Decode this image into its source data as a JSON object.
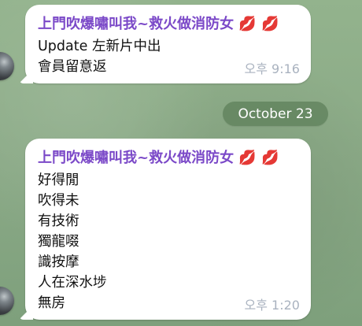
{
  "messages": [
    {
      "sender": "上門吹爆嘯叫我~救火做消防女 💋 💋",
      "lines": [
        "Update 左新片中出",
        "會員留意返"
      ],
      "time": "오후 9:16"
    },
    {
      "sender": "上門吹爆嘯叫我~救火做消防女 💋 💋",
      "lines": [
        "好得閒",
        "吹得未",
        "有技術",
        "獨龍啜",
        "識按摩",
        "人在深水埗",
        "無房"
      ],
      "time": "오후 1:20"
    }
  ],
  "date_separator": "October 23",
  "icons": {
    "avatar": "avatar-icon"
  },
  "colors": {
    "sender_name": "#7b49c8",
    "bubble": "#ffffff",
    "time": "#a9b2bf",
    "background": "#8fb08a",
    "date_pill": "#60825c"
  }
}
